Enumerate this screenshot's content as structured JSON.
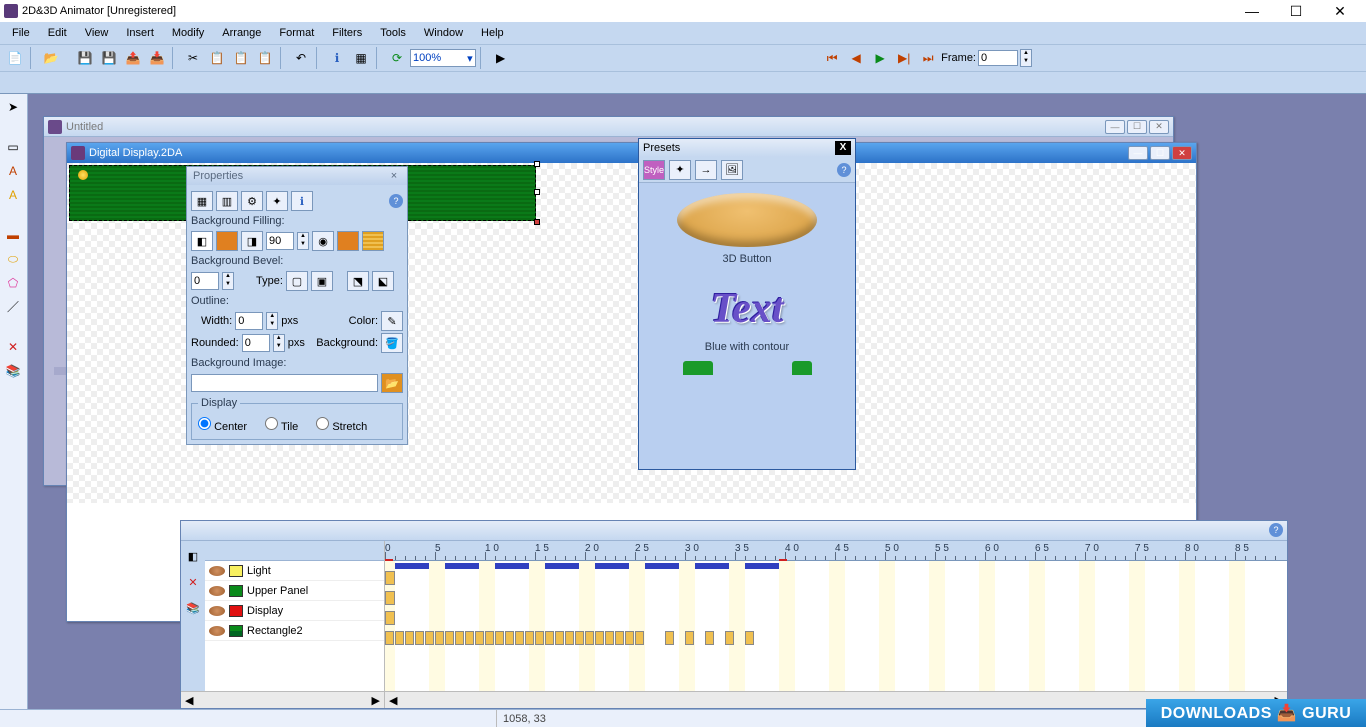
{
  "app": {
    "title": "2D&3D Animator [Unregistered]"
  },
  "menubar": [
    "File",
    "Edit",
    "View",
    "Insert",
    "Modify",
    "Arrange",
    "Format",
    "Filters",
    "Tools",
    "Window",
    "Help"
  ],
  "toolbar": {
    "zoom": "100%",
    "frame_label": "Frame:",
    "frame_value": "0"
  },
  "child_windows": {
    "untitled": {
      "title": "Untitled"
    },
    "document": {
      "title": "Digital Display.2DA"
    }
  },
  "properties": {
    "title": "Properties",
    "bg_fill_label": "Background Filling:",
    "fill_angle": "90",
    "bg_bevel_label": "Background Bevel:",
    "bevel_val": "0",
    "type_label": "Type:",
    "outline_label": "Outline:",
    "width_label": "Width:",
    "width_val": "0",
    "width_unit": "pxs",
    "color_label": "Color:",
    "rounded_label": "Rounded:",
    "rounded_val": "0",
    "rounded_unit": "pxs",
    "background_label": "Background:",
    "bg_image_label": "Background Image:",
    "display_group": "Display",
    "display_opts": [
      "Center",
      "Tile",
      "Stretch"
    ]
  },
  "presets": {
    "title": "Presets",
    "item1": "3D Button",
    "item2_text": "Text",
    "item2": "Blue with contour"
  },
  "timeline": {
    "layers": [
      {
        "name": "Light",
        "color": "#f8f060"
      },
      {
        "name": "Upper Panel",
        "color": "#0a8a1a"
      },
      {
        "name": "Display",
        "color": "#e01010"
      },
      {
        "name": "Rectangle2",
        "color": "#0a8a1a"
      }
    ],
    "ruler_marks": [
      "0",
      "5",
      "1 0",
      "1 5",
      "2 0",
      "2 5",
      "3 0",
      "3 5",
      "4 0",
      "4 5",
      "5 0",
      "5 5",
      "6 0",
      "6 5",
      "7 0",
      "7 5",
      "8 0",
      "8 5"
    ]
  },
  "status": {
    "coords": "1058, 33"
  },
  "brand": "DOWNLOADS 📥 GURU"
}
